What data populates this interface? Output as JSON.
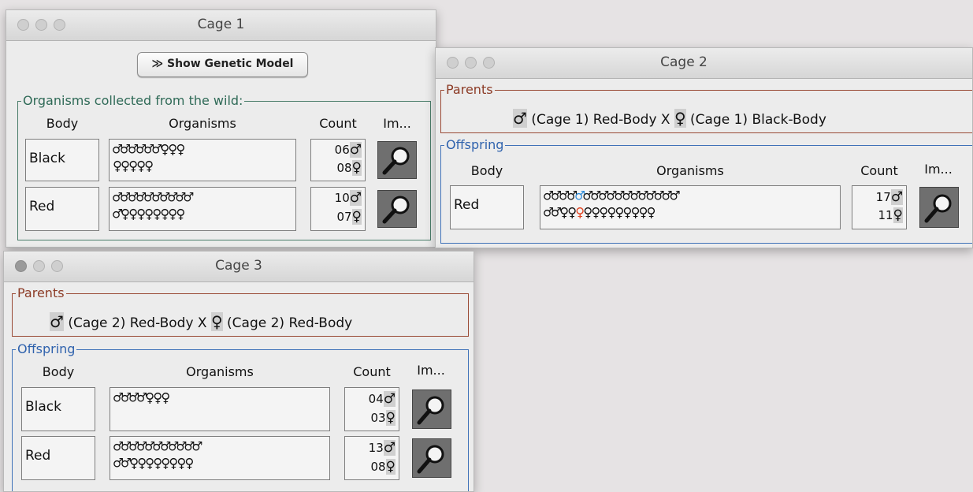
{
  "windows": {
    "cage1": {
      "title": "Cage 1",
      "button_label": "Show Genetic Model",
      "group_label": "Organisms collected from the wild:",
      "headers": {
        "body": "Body",
        "organisms": "Organisms",
        "count": "Count",
        "image": "Im..."
      },
      "rows": [
        {
          "body": "Black",
          "orgs_line1": "♂♂♂♂♂♂♀♀♀",
          "orgs_line2": "♀♀♀♀♀",
          "male_count": "06",
          "female_count": "08"
        },
        {
          "body": "Red",
          "orgs_line1": "♂♂♂♂♂♂♂♂♂♂",
          "orgs_line2": "♂♀♀♀♀♀♀♀♀",
          "male_count": "10",
          "female_count": "07"
        }
      ]
    },
    "cage2": {
      "title": "Cage 2",
      "parents_label": "Parents",
      "parents": {
        "male_sym": "♂",
        "male_text": "(Cage  1) Red-Body",
        "cross": "X",
        "female_sym": "♀",
        "female_text": "(Cage  1) Black-Body"
      },
      "offspring_label": "Offspring",
      "headers": {
        "body": "Body",
        "organisms": "Organisms",
        "count": "Count",
        "image": "Im..."
      },
      "row": {
        "body": "Red",
        "line1_pre": "♂♂♂♂",
        "line1_mark": "♂",
        "line1_post": "♂♂♂♂♂♂♂♂♂♂♂♂",
        "line2_pre": "♂♂♀♀",
        "line2_mark": "♀",
        "line2_post": "♀♀♀♀♀♀♀♀♀",
        "male_count": "17",
        "female_count": "11"
      }
    },
    "cage3": {
      "title": "Cage 3",
      "parents_label": "Parents",
      "parents": {
        "male_sym": "♂",
        "male_text": "(Cage  2) Red-Body",
        "cross": "X",
        "female_sym": "♀",
        "female_text": "(Cage  2) Red-Body"
      },
      "offspring_label": "Offspring",
      "headers": {
        "body": "Body",
        "organisms": "Organisms",
        "count": "Count",
        "image": "Im..."
      },
      "rows": [
        {
          "body": "Black",
          "orgs_line1": "♂♂♂♂♀♀♀",
          "orgs_line2": "",
          "male_count": "04",
          "female_count": "03"
        },
        {
          "body": "Red",
          "orgs_line1": "♂♂♂♂♂♂♂♂♂♂♂",
          "orgs_line2": "♂♂♀♀♀♀♀♀♀♀",
          "male_count": "13",
          "female_count": "08"
        }
      ]
    }
  },
  "symbols": {
    "male": "♂",
    "female": "♀"
  },
  "icons": {
    "traffic": "window-control-dots",
    "inspect": "magnifier-icon",
    "chevron": "double-chevron-right-icon"
  },
  "colors": {
    "highlight_male": "#2e8bd8",
    "highlight_female": "#e04422"
  }
}
